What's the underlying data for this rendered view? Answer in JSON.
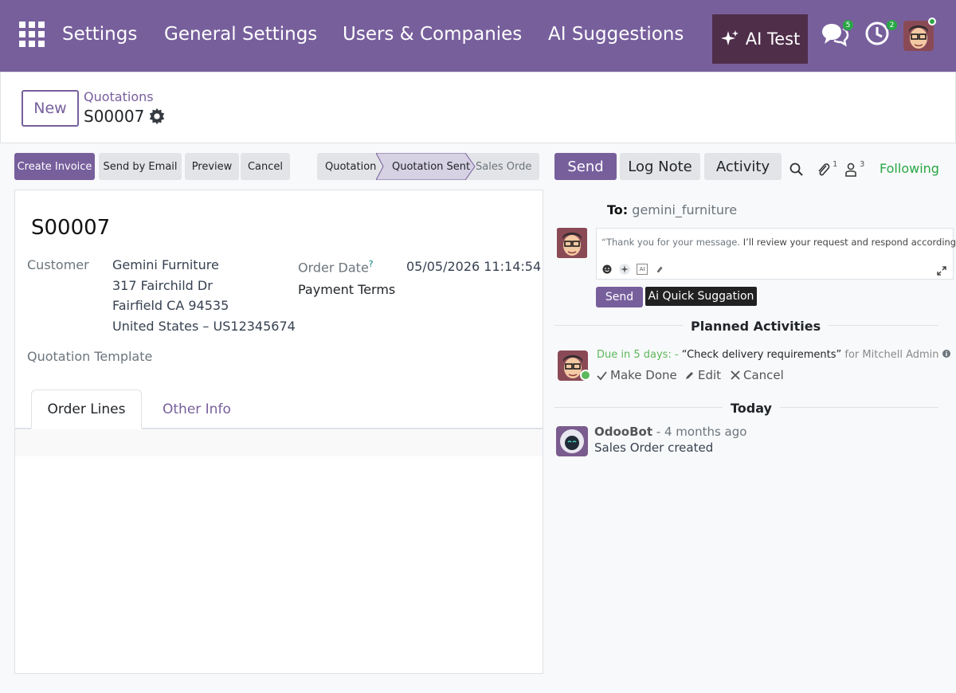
{
  "nav": {
    "menu_items": [
      "Settings",
      "General Settings",
      "Users & Companies",
      "AI Suggestions"
    ],
    "ai_button_label": "AI Test",
    "messages_count": "5",
    "activities_count": "2"
  },
  "control_panel": {
    "new_label": "New",
    "breadcrumb": "Quotations",
    "record_name": "S00007"
  },
  "actions": {
    "create_invoice": "Create Invoice",
    "send_by_email": "Send by Email",
    "preview": "Preview",
    "cancel": "Cancel"
  },
  "status_bar": {
    "stages": [
      "Quotation",
      "Quotation Sent",
      "Sales Orde"
    ],
    "active_stage": "Quotation Sent"
  },
  "form": {
    "title": "S00007",
    "customer_label": "Customer",
    "customer_name": "Gemini Furniture",
    "address_line1": "317 Fairchild Dr",
    "address_line2": "Fairfield CA 94535",
    "address_line3": "United States – US12345674",
    "order_date_label": "Order Date",
    "order_date_help": "?",
    "order_date_value": "05/05/2026 11:14:54",
    "payment_terms_label": "Payment Terms",
    "template_label": "Quotation Template",
    "tabs": [
      "Order Lines",
      "Other Info"
    ]
  },
  "chatter": {
    "send_label": "Send",
    "log_note_label": "Log Note",
    "activity_label": "Activity",
    "attachments_count": "1",
    "followers_count": "3",
    "following_label": "Following",
    "to_label": "To:",
    "to_value": "gemini_furniture",
    "composer_text_light": "“Thank you for your message.",
    "composer_text_dark": "I’ll review your request and respond accordingly.”",
    "composer_send": "Send",
    "ai_quick_label": "Ai Quick Suggation",
    "planned_title": "Planned Activities",
    "due_text": "Due in 5 days: -",
    "activity_summary": "“Check delivery requirements”",
    "activity_for": "for Mitchell Admin",
    "make_done": "Make Done",
    "edit": "Edit",
    "cancel": "Cancel",
    "today_title": "Today",
    "author": "OdooBot",
    "time": "- 4 months ago",
    "message": "Sales Order created"
  },
  "colors": {
    "brand": "#775f9c",
    "ai_button": "#4f2e4a",
    "following": "#28a745"
  }
}
